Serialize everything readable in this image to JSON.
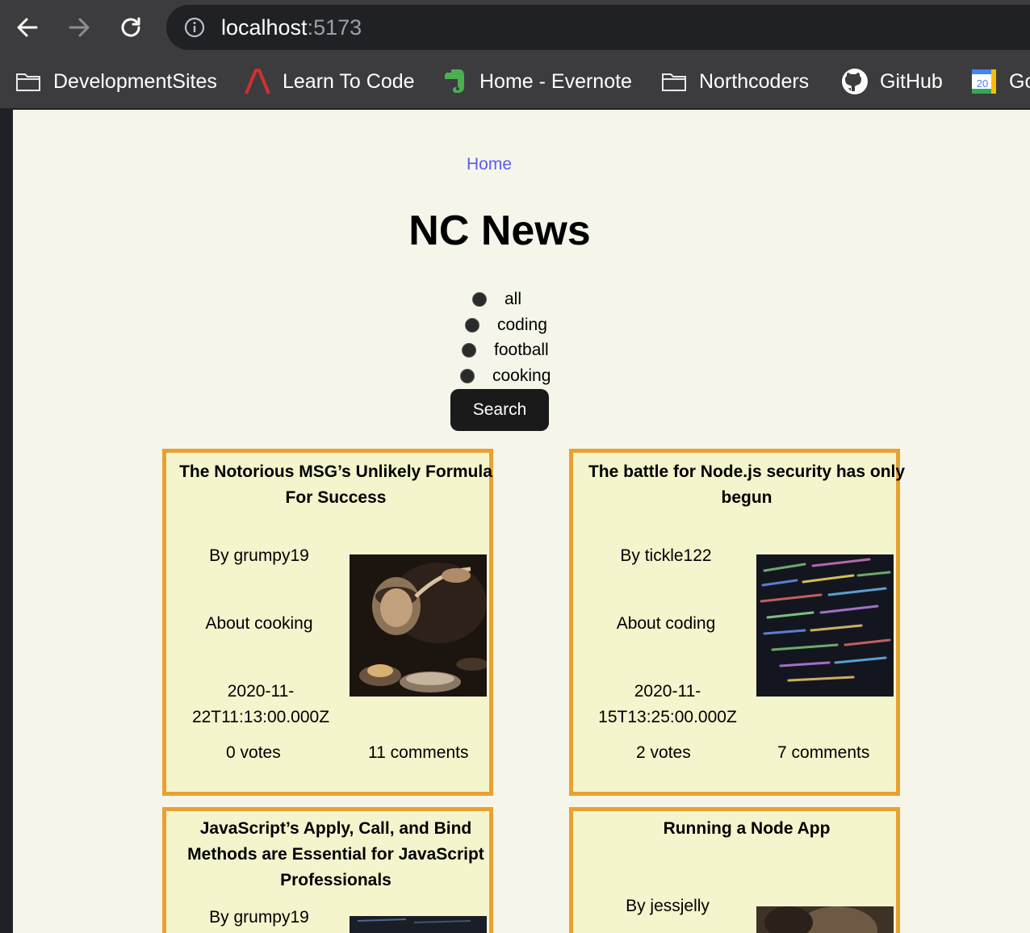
{
  "browser": {
    "url_host": "localhost",
    "url_port": ":5173",
    "bookmarks": [
      {
        "label": "DevelopmentSites",
        "icon": "folder-icon"
      },
      {
        "label": "Learn To Code",
        "icon": "angular-logo-icon"
      },
      {
        "label": "Home - Evernote",
        "icon": "evernote-icon"
      },
      {
        "label": "Northcoders",
        "icon": "folder-icon"
      },
      {
        "label": "GitHub",
        "icon": "github-icon"
      },
      {
        "label": "Go",
        "icon": "calendar-icon",
        "calendar_day": "20"
      }
    ]
  },
  "nav": {
    "home_label": "Home"
  },
  "site": {
    "title": "NC News"
  },
  "topics": {
    "options": [
      "all",
      "coding",
      "football",
      "cooking"
    ],
    "search_label": "Search"
  },
  "articles": [
    {
      "title": "The Notorious MSG’s Unlikely Formula For Success",
      "author": "By grumpy19",
      "topic": "About cooking",
      "date_line1": "2020-11-",
      "date_line2": "22T11:13:00.000Z",
      "votes": "0 votes",
      "comments": "11 comments",
      "image": "cooking-photo"
    },
    {
      "title": "The battle for Node.js security has only begun",
      "author": "By tickle122",
      "topic": "About coding",
      "date_line1": "2020-11-",
      "date_line2": "15T13:25:00.000Z",
      "votes": "2 votes",
      "comments": "7 comments",
      "image": "code-screen-photo"
    },
    {
      "title": "JavaScript’s Apply, Call, and Bind Methods are Essential for JavaScript Professionals",
      "author": "By grumpy19",
      "image": "code-screen-photo"
    },
    {
      "title": "Running a Node App",
      "author": "By jessjelly",
      "image": "person-photo"
    }
  ],
  "colors": {
    "page_bg": "#f5f6e9",
    "card_bg": "#f4f4cd",
    "card_border": "#e9a132",
    "link": "#5b5bf0",
    "button_bg": "#1a1a1a"
  }
}
